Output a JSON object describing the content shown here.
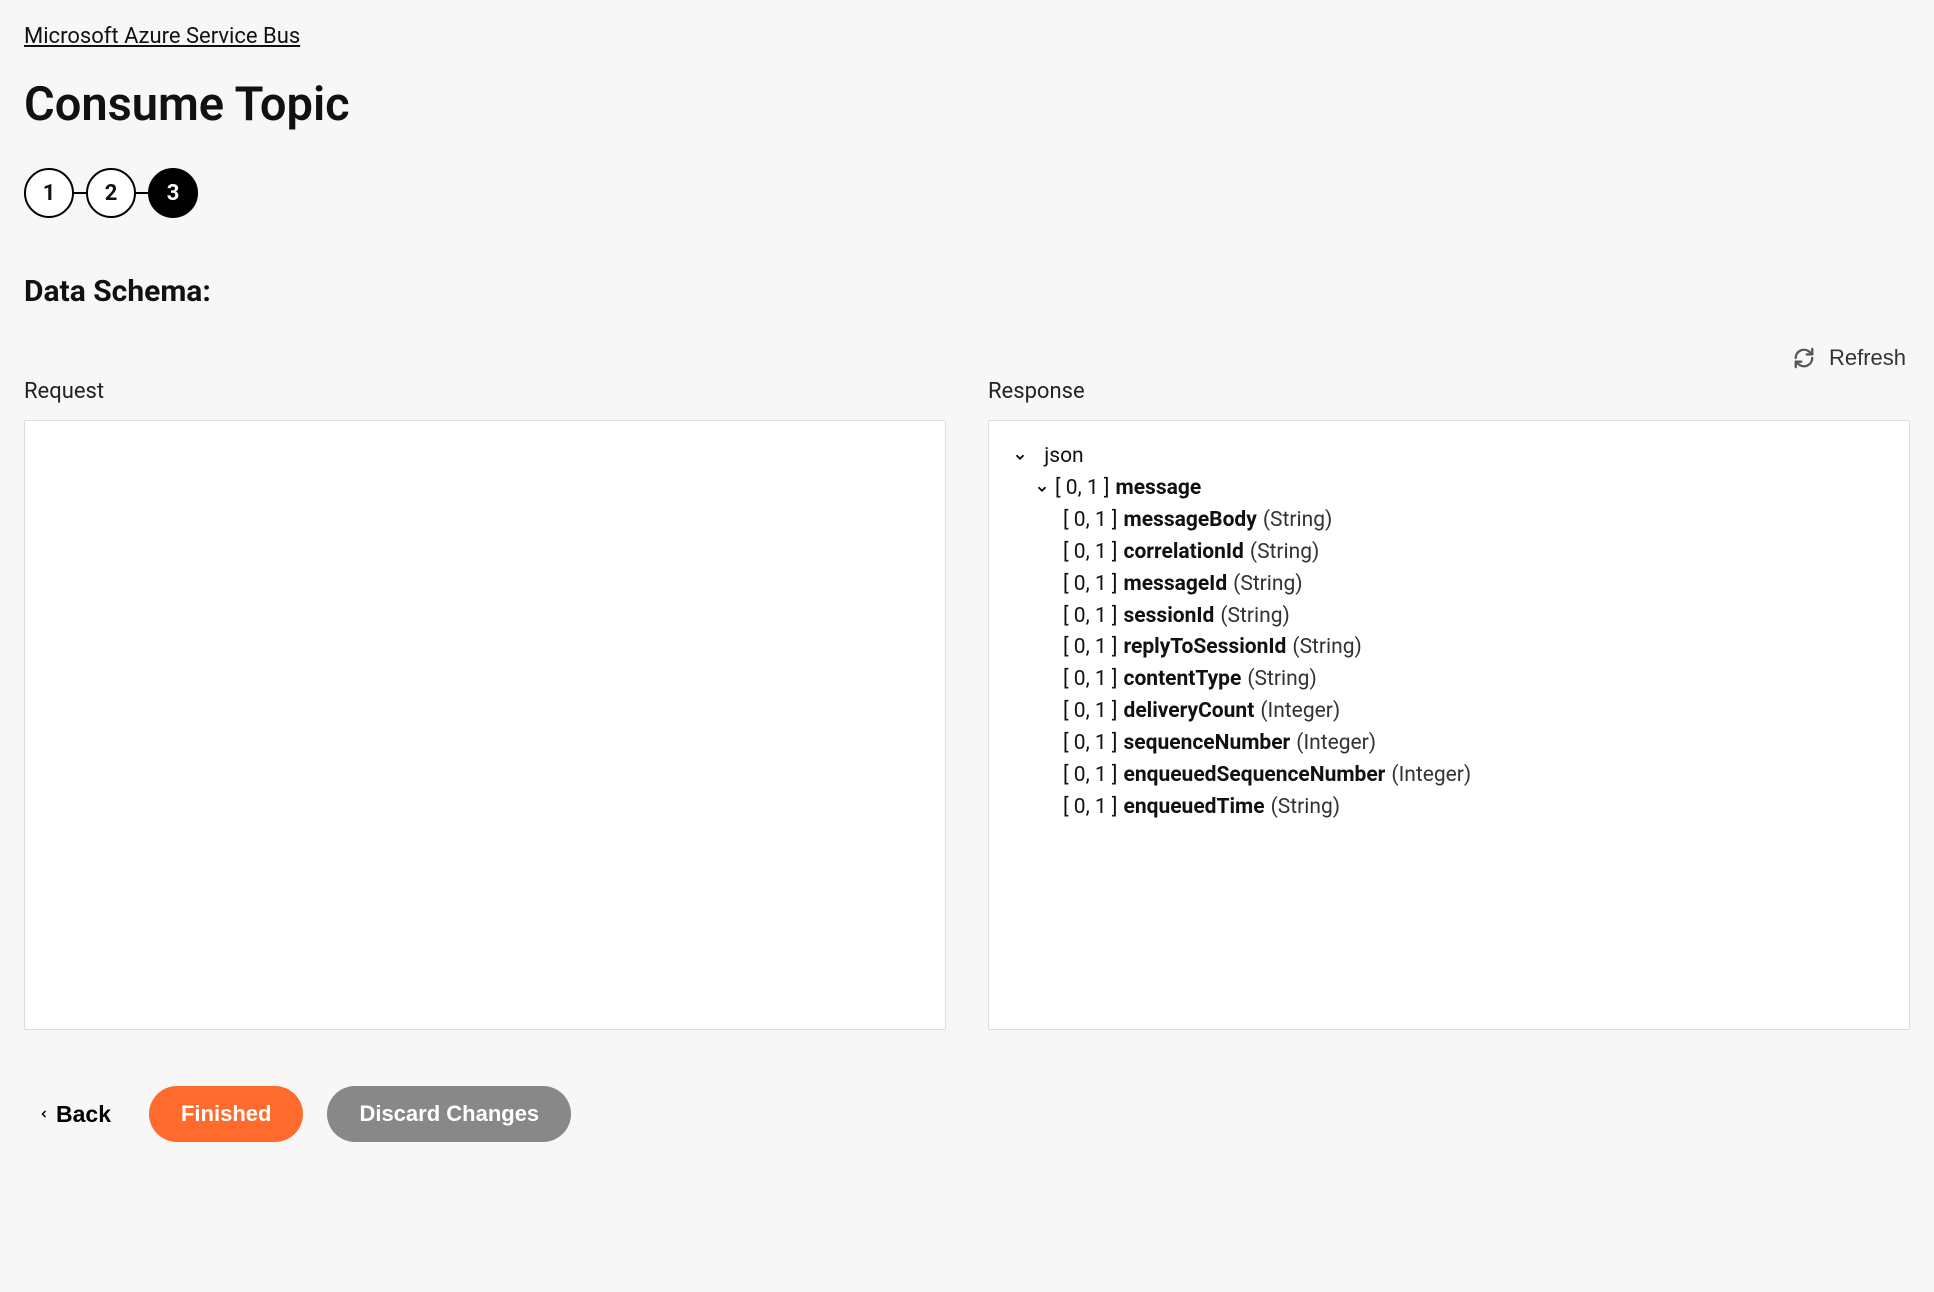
{
  "breadcrumb": "Microsoft Azure Service Bus",
  "page_title": "Consume Topic",
  "stepper": {
    "steps": [
      "1",
      "2",
      "3"
    ],
    "active_index": 2
  },
  "section_title": "Data Schema:",
  "refresh_label": "Refresh",
  "panels": {
    "request": {
      "label": "Request"
    },
    "response": {
      "label": "Response",
      "root_label": "json",
      "message_card": "[ 0, 1 ]",
      "message_name": "message",
      "fields": [
        {
          "card": "[ 0, 1 ]",
          "name": "messageBody",
          "type": "(String)"
        },
        {
          "card": "[ 0, 1 ]",
          "name": "correlationId",
          "type": "(String)"
        },
        {
          "card": "[ 0, 1 ]",
          "name": "messageId",
          "type": "(String)"
        },
        {
          "card": "[ 0, 1 ]",
          "name": "sessionId",
          "type": "(String)"
        },
        {
          "card": "[ 0, 1 ]",
          "name": "replyToSessionId",
          "type": "(String)"
        },
        {
          "card": "[ 0, 1 ]",
          "name": "contentType",
          "type": "(String)"
        },
        {
          "card": "[ 0, 1 ]",
          "name": "deliveryCount",
          "type": "(Integer)"
        },
        {
          "card": "[ 0, 1 ]",
          "name": "sequenceNumber",
          "type": "(Integer)"
        },
        {
          "card": "[ 0, 1 ]",
          "name": "enqueuedSequenceNumber",
          "type": "(Integer)"
        },
        {
          "card": "[ 0, 1 ]",
          "name": "enqueuedTime",
          "type": "(String)"
        }
      ]
    }
  },
  "footer": {
    "back": "Back",
    "finished": "Finished",
    "discard": "Discard Changes"
  }
}
